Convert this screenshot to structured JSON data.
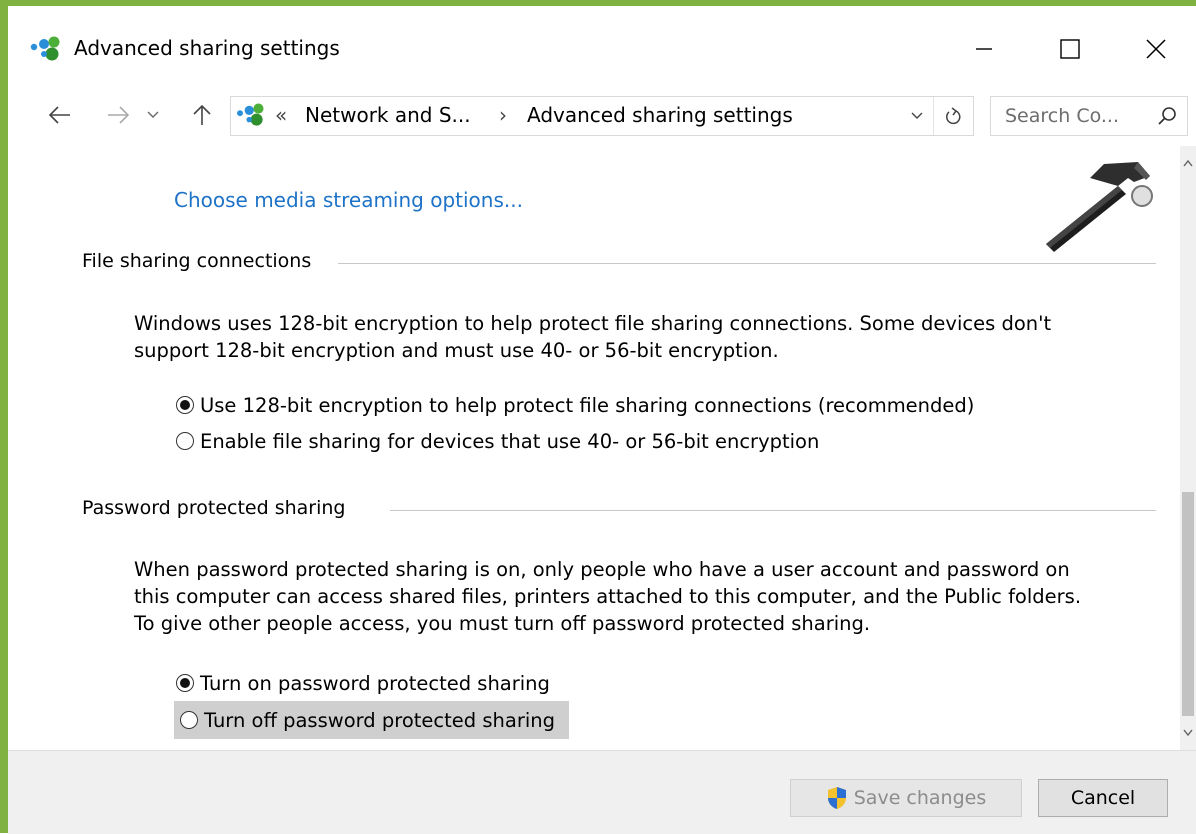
{
  "window": {
    "title": "Advanced sharing settings",
    "frame_color": "#7fb241"
  },
  "address_bar": {
    "overflow": "«",
    "crumbs": [
      "Network and S...",
      "Advanced sharing settings"
    ],
    "separator": "›",
    "refresh_icon": "refresh-icon",
    "dropdown_icon": "chevron-down-icon"
  },
  "search": {
    "placeholder": "Search Co...",
    "icon": "search-icon"
  },
  "content": {
    "media_link": "Choose media streaming options...",
    "file_sharing": {
      "title": "File sharing connections",
      "description_lines": [
        "Windows uses 128-bit encryption to help protect file sharing connections. Some devices don't",
        "support 128-bit encryption and must use 40- or 56-bit encryption."
      ],
      "options": [
        {
          "label": "Use 128-bit encryption to help protect file sharing connections (recommended)",
          "selected": true
        },
        {
          "label": "Enable file sharing for devices that use 40- or 56-bit encryption",
          "selected": false
        }
      ]
    },
    "password_sharing": {
      "title": "Password protected sharing",
      "description_lines": [
        "When password protected sharing is on, only people who have a user account and password on",
        "this computer can access shared files, printers attached to this computer, and the Public folders.",
        "To give other people access, you must turn off password protected sharing."
      ],
      "options": [
        {
          "label": "Turn on password protected sharing",
          "selected": true
        },
        {
          "label": "Turn off password protected sharing",
          "selected": false,
          "hovered": true
        }
      ]
    }
  },
  "footer": {
    "save_label": "Save changes",
    "save_enabled": false,
    "cancel_label": "Cancel"
  },
  "colors": {
    "link": "#1e73c8",
    "hover_row": "#cfcfcf",
    "footer_bg": "#f0f0f0"
  }
}
